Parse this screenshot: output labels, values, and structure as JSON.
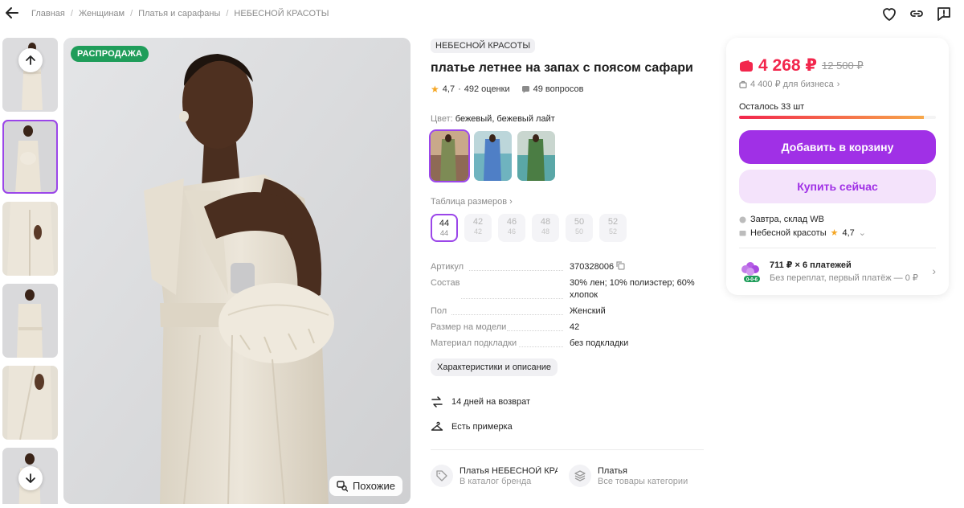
{
  "breadcrumbs": [
    "Главная",
    "Женщинам",
    "Платья и сарафаны",
    "НЕБЕСНОЙ КРАСОТЫ"
  ],
  "gallery": {
    "sale_badge": "РАСПРОДАЖА",
    "similar_label": "Похожие",
    "thumbnail_count": 6,
    "active_thumbnail": 2
  },
  "product": {
    "brand": "НЕБЕСНОЙ КРАСОТЫ",
    "title": "платье летнее на запах с поясом сафари",
    "rating": "4,7",
    "reviews": "492 оценки",
    "questions": "49 вопросов",
    "color_label": "Цвет:",
    "color_value": "бежевый, бежевый лайт",
    "size_table_label": "Таблица размеров",
    "sizes": [
      {
        "ru": "44",
        "sub": "44"
      },
      {
        "ru": "42",
        "sub": "42"
      },
      {
        "ru": "46",
        "sub": "46"
      },
      {
        "ru": "48",
        "sub": "48"
      },
      {
        "ru": "50",
        "sub": "50"
      },
      {
        "ru": "52",
        "sub": "52"
      }
    ],
    "specs": [
      {
        "key": "Артикул",
        "value": "370328006"
      },
      {
        "key": "Состав",
        "value": "30% лен; 10% полиэстер; 60% хлопок"
      },
      {
        "key": "Пол",
        "value": "Женский"
      },
      {
        "key": "Размер на модели",
        "value": "42"
      },
      {
        "key": "Материал подкладки",
        "value": "без подкладки"
      }
    ],
    "chars_button": "Характеристики и описание",
    "perks": [
      "14 дней на возврат",
      "Есть примерка"
    ],
    "categories": [
      {
        "title": "Платья НЕБЕСНОЙ КРАС",
        "subtitle": "В каталог бренда"
      },
      {
        "title": "Платья",
        "subtitle": "Все товары категории"
      }
    ]
  },
  "card": {
    "price": "4 268 ₽",
    "old_price": "12 500 ₽",
    "business_price": "4 400 ₽ для бизнеса",
    "stock_left": "Осталось 33 шт",
    "stock_fraction": 0.94,
    "add_to_cart": "Добавить в корзину",
    "buy_now": "Купить сейчас",
    "delivery": "Завтра, склад WB",
    "seller": "Небесной красоты",
    "seller_rating": "4,7",
    "installment_title": "711 ₽ × 6 платежей",
    "installment_sub": "Без переплат, первый платёж — 0 ₽",
    "installment_badge": "0-0-6"
  },
  "colors": {
    "accent": "#a030e6",
    "price": "#f2264c",
    "sale": "#1f9d5a"
  }
}
